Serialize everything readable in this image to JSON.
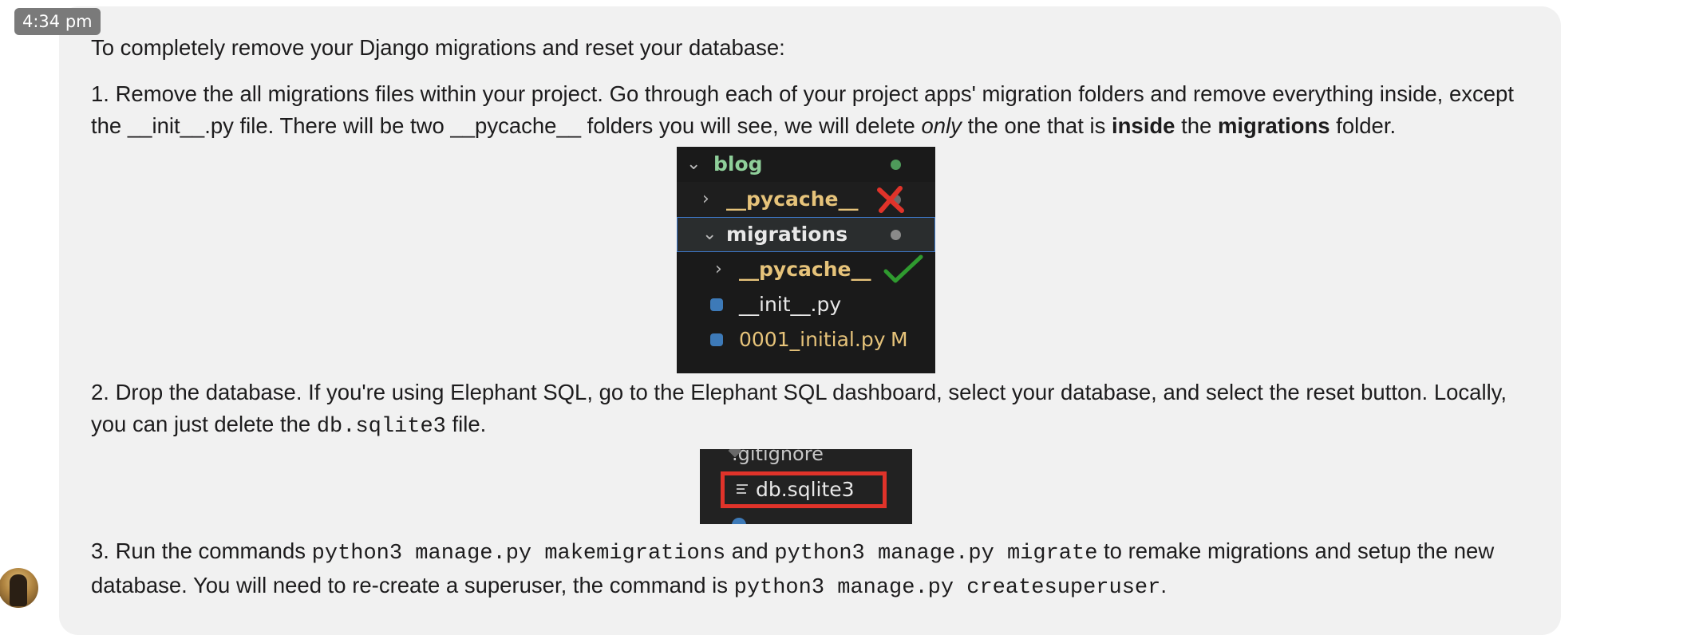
{
  "timestamp": "4:34 pm",
  "message": {
    "intro": "To completely remove your Django migrations and reset your database:",
    "step1": {
      "text_a": "1. Remove the all migrations files within your project. Go through each of your project apps' migration folders and remove everything inside, except the __init__.py file. There will be two __pycache__ folders you will see, we will delete ",
      "em": "only",
      "text_b": " the one that is ",
      "strong1": "inside",
      "text_c": " the ",
      "strong2": "migrations",
      "text_d": " folder."
    },
    "screenshot1": {
      "rows": [
        {
          "label": "blog",
          "color": "#8fcf9a"
        },
        {
          "label": "__pycache__",
          "color": "#e6c37a"
        },
        {
          "label": "migrations",
          "color": "#e8e8e8"
        },
        {
          "label": "__pycache__",
          "color": "#e6c37a"
        },
        {
          "label": "__init__.py",
          "color": "#e8e8e8"
        },
        {
          "label": "0001_initial.py",
          "color": "#e6c37a",
          "badge": "M"
        }
      ]
    },
    "step2": {
      "text_a": "2. Drop the database. If you're using Elephant SQL, go to the Elephant SQL dashboard, select your database, and select the reset button. Locally, you can just delete the ",
      "code": "db.sqlite3",
      "text_b": " file."
    },
    "screenshot2": {
      "top_file": ".gitignore",
      "file": "db.sqlite3",
      "highlight_color": "#e0332a"
    },
    "step3": {
      "text_a": "3. Run the commands ",
      "code1": "python3 manage.py makemigrations",
      "text_b": " and ",
      "code2": "python3 manage.py migrate",
      "text_c": " to remake migrations and setup the new database. You will need to re-create a superuser, the command is ",
      "code3": "python3 manage.py createsuperuser",
      "text_d": "."
    }
  },
  "icons": {
    "delete_mark": "red-x-icon",
    "keep_mark": "green-checkmark-icon"
  }
}
